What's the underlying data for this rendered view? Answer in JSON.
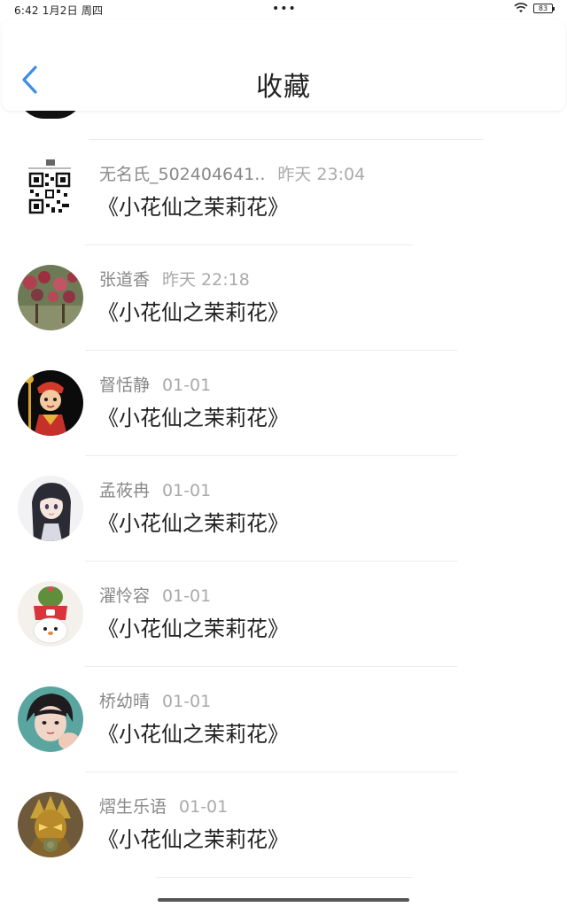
{
  "status_bar": {
    "time_date": "6:42  1月2日 周四",
    "dots": "•••",
    "battery": "83"
  },
  "header": {
    "title": "收藏",
    "back_icon": "chevron-left-icon"
  },
  "items": [
    {
      "name": "无名氏_502404641..",
      "time": "昨天 23:04",
      "title": "《小花仙之茉莉花》",
      "avatar": "qr-code"
    },
    {
      "name": "张道香",
      "time": "昨天 22:18",
      "title": "《小花仙之茉莉花》",
      "avatar": "flower-bush"
    },
    {
      "name": "督恬静",
      "time": "01-01",
      "title": "《小花仙之茉莉花》",
      "avatar": "cartoon-monk"
    },
    {
      "name": "孟莜冉",
      "time": "01-01",
      "title": "《小花仙之茉莉花》",
      "avatar": "anime-girl"
    },
    {
      "name": "濯怜容",
      "time": "01-01",
      "title": "《小花仙之茉莉花》",
      "avatar": "cactus-toy"
    },
    {
      "name": "桥幼晴",
      "time": "01-01",
      "title": "《小花仙之茉莉花》",
      "avatar": "child-photo"
    },
    {
      "name": "熠生乐语",
      "time": "01-01",
      "title": "《小花仙之茉莉花》",
      "avatar": "golden-armor"
    }
  ],
  "colors": {
    "accent": "#3a8ee6",
    "name_text": "#888888",
    "time_text": "#aaaaaa",
    "title_text": "#222222"
  }
}
